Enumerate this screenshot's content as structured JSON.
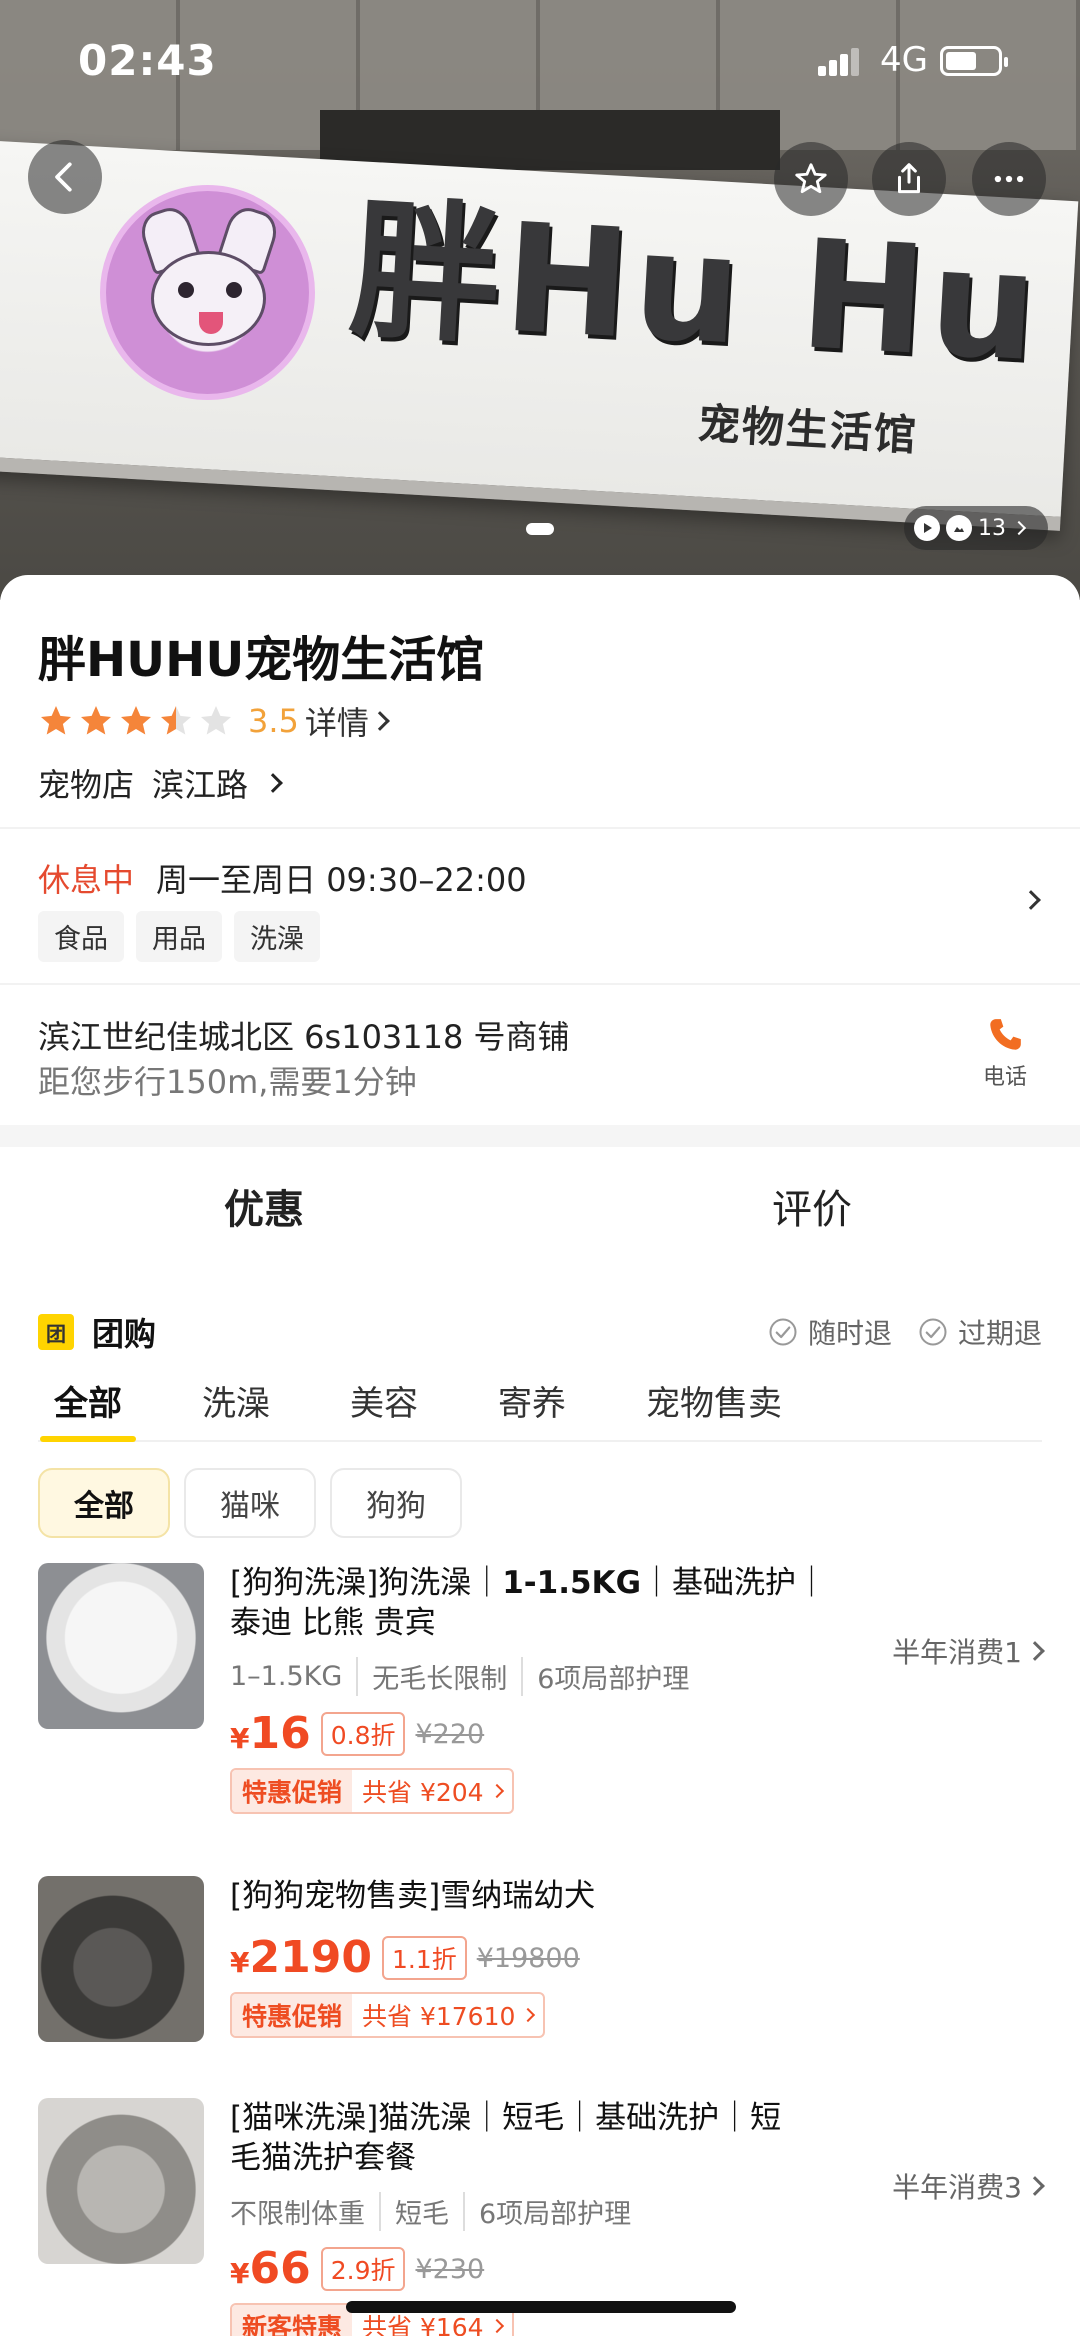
{
  "status_bar": {
    "time": "02:43",
    "network": "4G"
  },
  "hero": {
    "brand_text": "胖Hu Hu",
    "brand_sub": "宠物生活馆",
    "media_count": "13"
  },
  "shop": {
    "name": "胖HUHU宠物生活馆",
    "rating": 3.5,
    "rating_text": "3.5",
    "detail_label": "详情",
    "category": "宠物店",
    "area": "滨江路",
    "status": "休息中",
    "hours": "周一至周日 09:30–22:00",
    "tags": [
      "食品",
      "用品",
      "洗澡"
    ],
    "address": "滨江世纪佳城北区 6s103118 号商铺",
    "distance": "距您步行150m,需要1分钟",
    "phone_label": "电话"
  },
  "tabs": {
    "offers": "优惠",
    "reviews": "评价"
  },
  "group_buy": {
    "badge": "团",
    "title": "团购",
    "guarantees": [
      "随时退",
      "过期退"
    ],
    "sub_tabs": [
      "全部",
      "洗澡",
      "美容",
      "寄养",
      "宠物售卖"
    ],
    "chips": [
      "全部",
      "猫咪",
      "狗狗"
    ]
  },
  "deals": [
    {
      "title_line1": "[狗狗洗澡]狗洗澡｜",
      "title_bold1": "1-1.5KG",
      "title_line1b": "｜基础洗护｜",
      "title_line2": "泰迪 比熊 贵宾",
      "attrs": [
        "1–1.5KG",
        "无毛长限制",
        "6项局部护理"
      ],
      "price_symbol": "¥",
      "price": "16",
      "discount": "0.8折",
      "original": "¥220",
      "promo_tag": "特惠促销",
      "promo_save": "共省 ¥204",
      "sales": "半年消费1"
    },
    {
      "title_line1": "[狗狗宠物售卖]雪纳瑞幼犬",
      "price_symbol": "¥",
      "price": "2190",
      "discount": "1.1折",
      "original": "¥19800",
      "promo_tag": "特惠促销",
      "promo_save": "共省 ¥17610"
    },
    {
      "title_line1": "[猫咪洗澡]猫洗澡｜短毛｜基础洗护｜短",
      "title_line2": "毛猫洗护套餐",
      "attrs": [
        "不限制体重",
        "短毛",
        "6项局部护理"
      ],
      "price_symbol": "¥",
      "price": "66",
      "discount": "2.9折",
      "original": "¥230",
      "promo_tag": "新客特惠",
      "promo_save": "共省 ¥164",
      "sales": "半年消费3"
    }
  ],
  "colors": {
    "accent_yellow": "#ffd400",
    "price_red": "#f04a23",
    "star_orange": "#f5853a",
    "closed_red": "#e54a2f"
  }
}
